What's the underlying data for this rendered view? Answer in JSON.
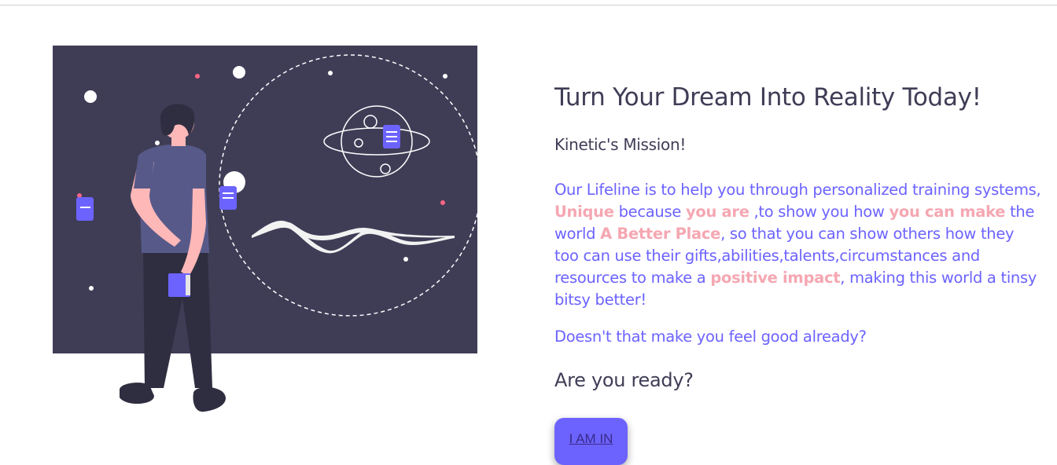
{
  "hero": {
    "title": "Turn Your Dream Into Reality Today!",
    "subtitle": "Kinetic's Mission!",
    "mission": [
      {
        "text": "Our Lifeline is to help you through personalized training systems, ",
        "highlight": false
      },
      {
        "text": "Unique",
        "highlight": true
      },
      {
        "text": " because ",
        "highlight": false
      },
      {
        "text": "you are",
        "highlight": true
      },
      {
        "text": " ,to show you how ",
        "highlight": false
      },
      {
        "text": "you can make",
        "highlight": true
      },
      {
        "text": " the world ",
        "highlight": false
      },
      {
        "text": "A Better Place",
        "highlight": true
      },
      {
        "text": ", so that you can show others how they too can use their gifts,abilities,talents,circumstances and resources to make a ",
        "highlight": false
      },
      {
        "text": "positive impact",
        "highlight": true
      },
      {
        "text": ", making this world a tinsy bitsy better!",
        "highlight": false
      }
    ],
    "question": "Doesn't that make you feel good already?",
    "cta_heading": "Are you ready?",
    "cta_label": "I AM IN"
  },
  "illustration": {
    "icons": [
      "person-icon",
      "planet-icon",
      "note-icon",
      "star-icon",
      "mountain-icon"
    ],
    "colors": {
      "board": "#3f3d56",
      "accent": "#6c63ff",
      "skin": "#ffb8b8",
      "shirt": "#575a89",
      "pants": "#2f2e41",
      "pink_dot": "#ff6584",
      "highlight": "#f5a7b2"
    }
  }
}
